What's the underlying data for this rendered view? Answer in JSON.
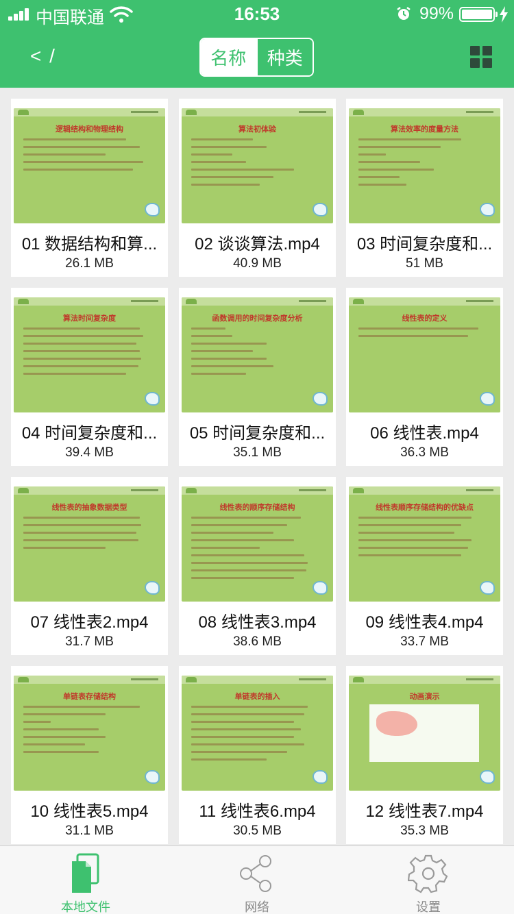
{
  "status_bar": {
    "carrier": "中国联通",
    "time": "16:53",
    "battery_percent": "99%",
    "battery_level": 0.99,
    "icons": [
      "signal-icon",
      "wifi-icon",
      "alarm-icon",
      "battery-icon",
      "charging-bolt-icon"
    ]
  },
  "nav": {
    "back_label": "< /",
    "segment_options": [
      "名称",
      "种类"
    ],
    "selected_segment": "名称",
    "right_icon": "grid-view-icon"
  },
  "files": [
    {
      "name": "01 数据结构和算...",
      "size": "26.1 MB",
      "slide_title": "逻辑结构和物理结构"
    },
    {
      "name": "02 谈谈算法.mp4",
      "size": "40.9 MB",
      "slide_title": "算法初体验"
    },
    {
      "name": "03 时间复杂度和...",
      "size": "51 MB",
      "slide_title": "算法效率的度量方法"
    },
    {
      "name": "04 时间复杂度和...",
      "size": "39.4 MB",
      "slide_title": "算法时间复杂度"
    },
    {
      "name": "05 时间复杂度和...",
      "size": "35.1 MB",
      "slide_title": "函数调用的时间复杂度分析"
    },
    {
      "name": "06 线性表.mp4",
      "size": "36.3 MB",
      "slide_title": "线性表的定义"
    },
    {
      "name": "07 线性表2.mp4",
      "size": "31.7 MB",
      "slide_title": "线性表的抽象数据类型"
    },
    {
      "name": "08 线性表3.mp4",
      "size": "38.6 MB",
      "slide_title": "线性表的顺序存储结构"
    },
    {
      "name": "09 线性表4.mp4",
      "size": "33.7 MB",
      "slide_title": "线性表顺序存储结构的优缺点"
    },
    {
      "name": "10 线性表5.mp4",
      "size": "31.1 MB",
      "slide_title": "单链表存储结构"
    },
    {
      "name": "11 线性表6.mp4",
      "size": "30.5 MB",
      "slide_title": "单链表的插入"
    },
    {
      "name": "12 线性表7.mp4",
      "size": "35.3 MB",
      "slide_title": "动画演示"
    }
  ],
  "tabbar": {
    "tabs": [
      {
        "label": "本地文件",
        "icon": "local-files-icon",
        "active": true
      },
      {
        "label": "网络",
        "icon": "share-network-icon",
        "active": false
      },
      {
        "label": "设置",
        "icon": "gear-icon",
        "active": false
      }
    ]
  },
  "colors": {
    "accent": "#3ec16f",
    "slide_bg": "#a6cd6a",
    "slide_title": "#c0392b",
    "inactive_tab": "#8a8a8a"
  }
}
